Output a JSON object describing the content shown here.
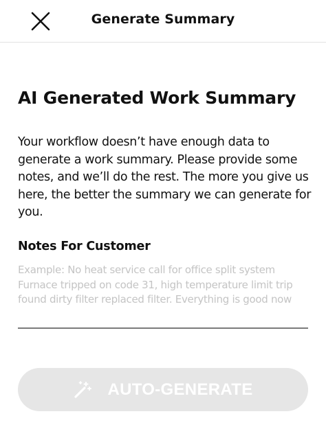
{
  "header": {
    "title": "Generate Summary",
    "close_icon": "close-icon"
  },
  "main": {
    "title": "AI Generated Work Summary",
    "description": "Your workflow doesn’t have enough data to generate a work summary. Please provide some notes, and we’ll do the rest. The more you give us here, the better the summary we can generate for you.",
    "notes_label": "Notes For Customer",
    "notes_value": "",
    "notes_placeholder": "Example: No heat service call for office split system Furnace tripped on code 31, high temperature limit trip found dirty filter replaced filter. Everything is good now"
  },
  "footer": {
    "button_label": "AUTO-GENERATE",
    "button_icon": "magic-wand-icon",
    "button_state": "disabled"
  },
  "colors": {
    "text": "#111111",
    "placeholder": "#c4c4c4",
    "button_disabled_bg": "#e6e6e6",
    "button_text": "#ffffff",
    "divider": "#e2e2e2"
  }
}
